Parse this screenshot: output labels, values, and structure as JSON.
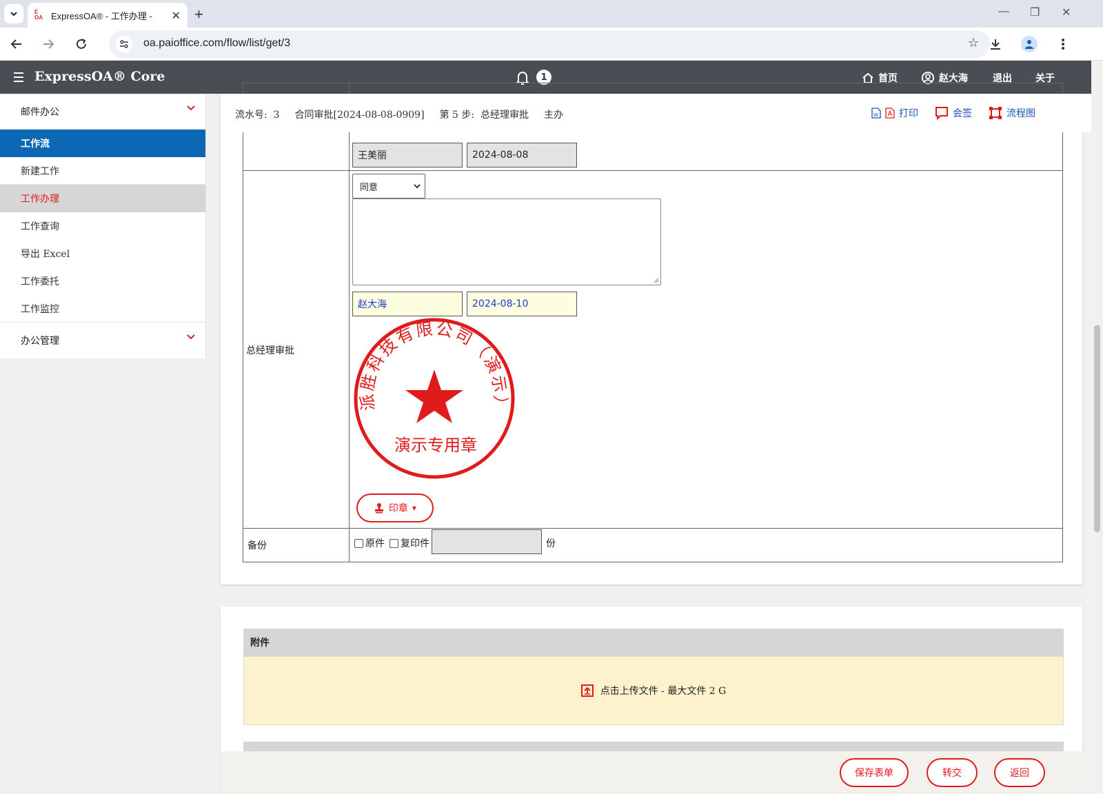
{
  "browser": {
    "tab_title": "ExpressOA® - 工作办理 - ",
    "favicon_text": "E OA",
    "url": "oa.paioffice.com/flow/list/get/3"
  },
  "header": {
    "app_title": "ExpressOA® Core",
    "notification_count": "1",
    "home": "首页",
    "user": "赵大海",
    "logout": "退出",
    "about": "关于"
  },
  "sidebar": {
    "groups": [
      {
        "label": "邮件办公"
      },
      {
        "label": "办公管理"
      }
    ],
    "active_section": "工作流",
    "items": [
      {
        "label": "新建工作"
      },
      {
        "label": "工作办理"
      },
      {
        "label": "工作查询"
      },
      {
        "label": "导出 Excel"
      },
      {
        "label": "工作委托"
      },
      {
        "label": "工作监控"
      }
    ]
  },
  "flow": {
    "serial_label": "流水号:",
    "serial_value": "3",
    "flow_name": "合同审批[2024-08-08-0909]",
    "step": "第 5 步:",
    "step_name": "总经理审批",
    "role": "主办",
    "print": "打印",
    "countersign": "会签",
    "flowchart": "流程图"
  },
  "form": {
    "prev_signer": "王美丽",
    "prev_date": "2024-08-08",
    "gm_label": "总经理审批",
    "decision": "同意",
    "comment": "",
    "signer": "赵大海",
    "sign_date": "2024-08-10",
    "seal": {
      "company": "派胜科技有限公司（演示）",
      "purpose": "演示专用章"
    },
    "stamp_button": "印章",
    "backup_label": "备份",
    "original": "原件",
    "copy": "复印件",
    "copies_value": "",
    "copies_unit": "份"
  },
  "attachments": {
    "title": "附件",
    "upload_text": "点击上传文件 - 最大文件 2 G"
  },
  "footer": {
    "save": "保存表单",
    "transfer": "转交",
    "back": "返回"
  },
  "colors": {
    "active_blue": "#0c68b5",
    "accent_red": "#e01b1b",
    "header_bg": "#494e54",
    "attach_bg": "#fcf2cd",
    "signature_text": "#1a3cc8"
  }
}
